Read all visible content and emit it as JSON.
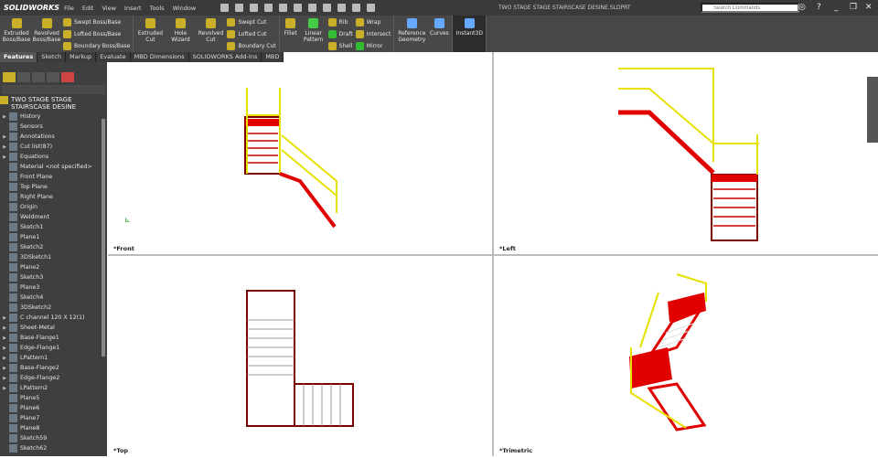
{
  "app": {
    "logo": "SOLIDWORKS",
    "title": "TWO STAGE STAGE STAIRSCASE DESINE.SLDPRT",
    "menu": [
      "File",
      "Edit",
      "View",
      "Insert",
      "Tools",
      "Window"
    ],
    "search_placeholder": "Search Commands"
  },
  "commands": {
    "extruded_boss": "Extruded Boss/Base",
    "revolved_boss": "Revolved Boss/Base",
    "swept_boss": "Swept Boss/Base",
    "lofted_boss": "Lofted Boss/Base",
    "boundary_boss": "Boundary Boss/Base",
    "extruded_cut": "Extruded Cut",
    "hole_wizard": "Hole Wizard",
    "revolved_cut": "Revolved Cut",
    "swept_cut": "Swept Cut",
    "lofted_cut": "Lofted Cut",
    "boundary_cut": "Boundary Cut",
    "fillet": "Fillet",
    "linear_pattern": "Linear Pattern",
    "rib": "Rib",
    "draft": "Draft",
    "shell": "Shell",
    "wrap": "Wrap",
    "intersect": "Intersect",
    "mirror": "Mirror",
    "reference_geometry": "Reference Geometry",
    "curves": "Curves",
    "instant3d": "Instant3D"
  },
  "tabs": [
    "Features",
    "Sketch",
    "Markup",
    "Evaluate",
    "MBD Dimensions",
    "SOLIDWORKS Add-Ins",
    "MBD"
  ],
  "tree": {
    "root": "TWO STAGE STAGE STAIRSCASE DESINE",
    "items": [
      {
        "label": "History",
        "exp": true
      },
      {
        "label": "Sensors",
        "exp": false
      },
      {
        "label": "Annotations",
        "exp": true
      },
      {
        "label": "Cut list(87)",
        "exp": true
      },
      {
        "label": "Equations",
        "exp": true
      },
      {
        "label": "Material <not specified>",
        "exp": false
      },
      {
        "label": "Front Plane",
        "exp": false
      },
      {
        "label": "Top Plane",
        "exp": false
      },
      {
        "label": "Right Plane",
        "exp": false
      },
      {
        "label": "Origin",
        "exp": false
      },
      {
        "label": "Weldment",
        "exp": false
      },
      {
        "label": "Sketch1",
        "exp": false
      },
      {
        "label": "Plane1",
        "exp": false
      },
      {
        "label": "Sketch2",
        "exp": false
      },
      {
        "label": "3DSketch1",
        "exp": false
      },
      {
        "label": "Plane2",
        "exp": false
      },
      {
        "label": "Sketch3",
        "exp": false
      },
      {
        "label": "Plane3",
        "exp": false
      },
      {
        "label": "Sketch4",
        "exp": false
      },
      {
        "label": "3DSketch2",
        "exp": false
      },
      {
        "label": "C channel 120 X 12(1)",
        "exp": true
      },
      {
        "label": "Sheet-Metal",
        "exp": true
      },
      {
        "label": "Base-Flange1",
        "exp": true
      },
      {
        "label": "Edge-Flange1",
        "exp": true
      },
      {
        "label": "LPattern1",
        "exp": true
      },
      {
        "label": "Base-Flange2",
        "exp": true
      },
      {
        "label": "Edge-Flange2",
        "exp": true
      },
      {
        "label": "LPattern2",
        "exp": true
      },
      {
        "label": "Plane5",
        "exp": false
      },
      {
        "label": "Plane6",
        "exp": false
      },
      {
        "label": "Plane7",
        "exp": false
      },
      {
        "label": "Plane8",
        "exp": false
      },
      {
        "label": "Sketch59",
        "exp": false
      },
      {
        "label": "Sketch62",
        "exp": false
      }
    ]
  },
  "viewports": [
    "*Front",
    "*Left",
    "*Top",
    "*Trimetric"
  ],
  "colors": {
    "rail": "#e8e000",
    "tread": "#e00000",
    "frame": "#7a0000"
  }
}
